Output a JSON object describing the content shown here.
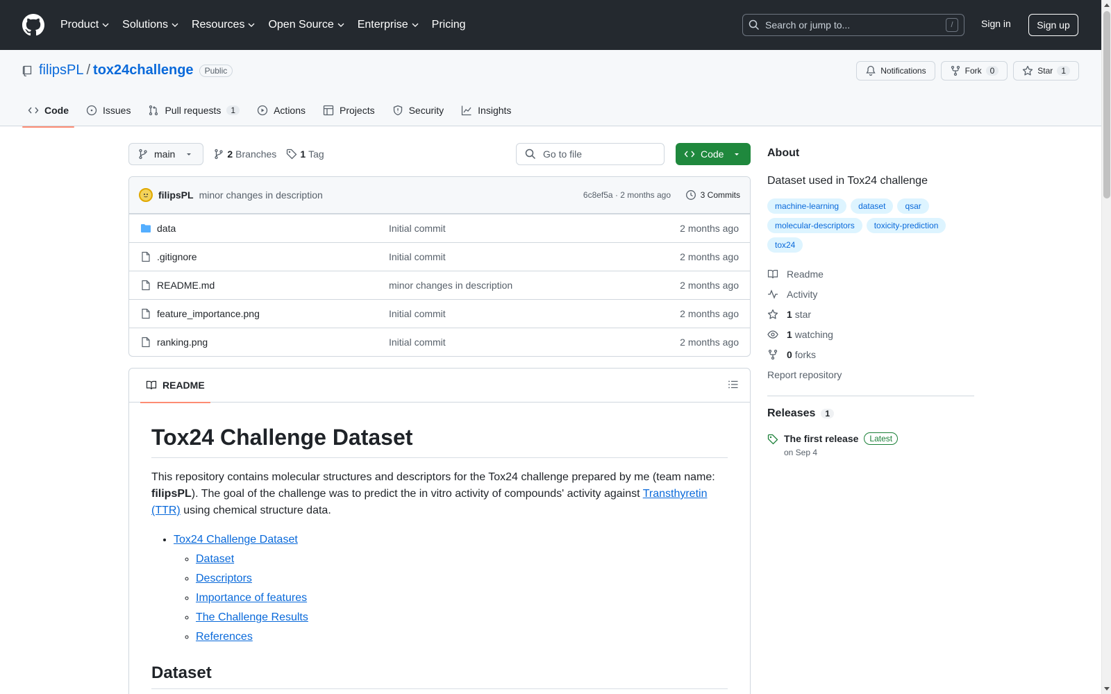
{
  "header": {
    "nav": [
      "Product",
      "Solutions",
      "Resources",
      "Open Source",
      "Enterprise",
      "Pricing"
    ],
    "search_placeholder": "Search or jump to...",
    "search_shortcut": "/",
    "sign_in": "Sign in",
    "sign_up": "Sign up"
  },
  "repo": {
    "owner": "filipsPL",
    "separator": "/",
    "name": "tox24challenge",
    "visibility": "Public",
    "notifications_label": "Notifications",
    "fork_label": "Fork",
    "fork_count": "0",
    "star_label": "Star",
    "star_count": "1"
  },
  "tabs": [
    {
      "label": "Code"
    },
    {
      "label": "Issues"
    },
    {
      "label": "Pull requests",
      "count": "1"
    },
    {
      "label": "Actions"
    },
    {
      "label": "Projects"
    },
    {
      "label": "Security"
    },
    {
      "label": "Insights"
    }
  ],
  "toolbar": {
    "branch": "main",
    "branches_count": "2",
    "branches_label": "Branches",
    "tags_count": "1",
    "tags_label": "Tag",
    "goto_placeholder": "Go to file",
    "code_label": "Code"
  },
  "commit": {
    "author": "filipsPL",
    "message": "minor changes in description",
    "meta": "6c8ef5a · 2 months ago",
    "count_label": "3 Commits"
  },
  "files": [
    {
      "name": "data",
      "type": "folder",
      "message": "Initial commit",
      "age": "2 months ago"
    },
    {
      "name": ".gitignore",
      "type": "file",
      "message": "Initial commit",
      "age": "2 months ago"
    },
    {
      "name": "README.md",
      "type": "file",
      "message": "minor changes in description",
      "age": "2 months ago"
    },
    {
      "name": "feature_importance.png",
      "type": "file",
      "message": "Initial commit",
      "age": "2 months ago"
    },
    {
      "name": "ranking.png",
      "type": "file",
      "message": "Initial commit",
      "age": "2 months ago"
    }
  ],
  "readme": {
    "tab_label": "README",
    "title": "Tox24 Challenge Dataset",
    "intro_1": "This repository contains molecular structures and descriptors for the Tox24 challenge prepared by me (team name: ",
    "intro_bold": "filipsPL",
    "intro_2": "). The goal of the challenge was to predict the in vitro activity of compounds' activity against ",
    "intro_link": "Transthyretin (TTR)",
    "intro_3": " using chemical structure data.",
    "toc_main": "Tox24 Challenge Dataset",
    "toc_items": [
      "Dataset",
      "Descriptors",
      "Importance of features",
      "The Challenge Results",
      "References"
    ],
    "section_dataset": "Dataset"
  },
  "about": {
    "heading": "About",
    "description": "Dataset used in Tox24 challenge",
    "topics": [
      "machine-learning",
      "dataset",
      "qsar",
      "molecular-descriptors",
      "toxicity-prediction",
      "tox24"
    ],
    "readme_label": "Readme",
    "activity_label": "Activity",
    "stars_count": "1",
    "stars_label": "star",
    "watching_count": "1",
    "watching_label": "watching",
    "forks_count": "0",
    "forks_label": "forks",
    "report_label": "Report repository"
  },
  "releases": {
    "heading": "Releases",
    "count": "1",
    "title": "The first release",
    "badge": "Latest",
    "date": "on Sep 4"
  }
}
